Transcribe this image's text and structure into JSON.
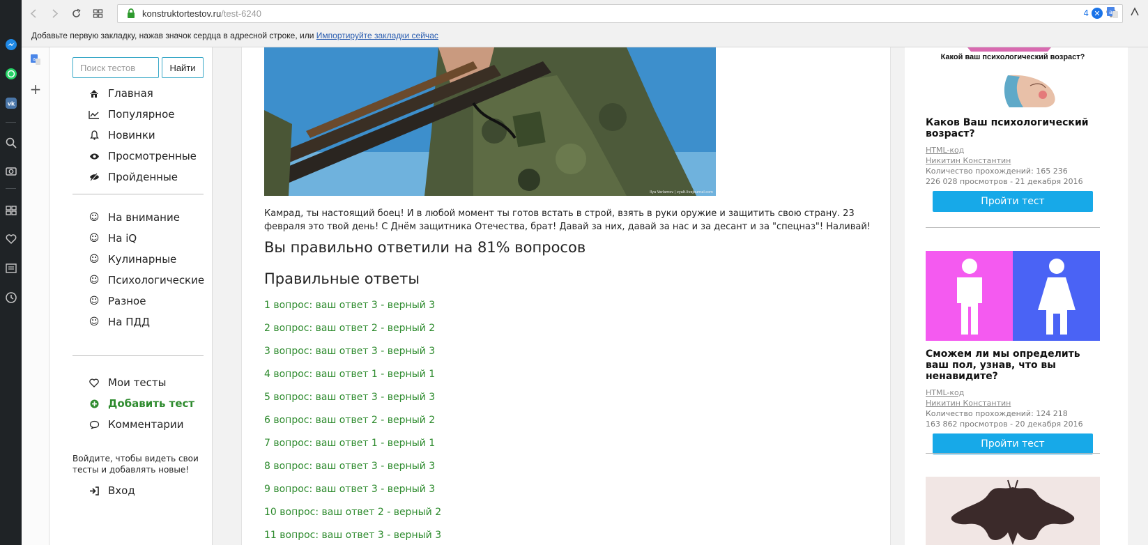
{
  "browser": {
    "url_host": "konstruktortestov.ru",
    "url_path": "/test-6240",
    "address_badge": "4",
    "bookmark_bar": {
      "text": "Добавьте первую закладку, нажав значок сердца в адресной строке, или",
      "link": "Импортируйте закладки сейчас"
    }
  },
  "sidebar": {
    "search_placeholder": "Поиск тестов",
    "search_button": "Найти",
    "main_menu": [
      {
        "label": "Главная",
        "icon": "home-icon",
        "glyph": "⌂"
      },
      {
        "label": "Популярное",
        "icon": "trend-icon",
        "glyph": "📈"
      },
      {
        "label": "Новинки",
        "icon": "bell-icon",
        "glyph": "🔔"
      },
      {
        "label": "Просмотренные",
        "icon": "eye-icon",
        "glyph": "👁"
      },
      {
        "label": "Пройденные",
        "icon": "eye-slash-icon",
        "glyph": "👁"
      }
    ],
    "categories": [
      {
        "label": "На внимание",
        "icon": "smile-icon"
      },
      {
        "label": "На iQ",
        "icon": "smile-icon"
      },
      {
        "label": "Кулинарные",
        "icon": "smile-icon"
      },
      {
        "label": "Психологические",
        "icon": "smile-icon"
      },
      {
        "label": "Разное",
        "icon": "smile-icon"
      },
      {
        "label": "На ПДД",
        "icon": "smile-icon"
      }
    ],
    "user_menu": {
      "my_tests": "Мои тесты",
      "add_test": "Добавить тест",
      "comments": "Комментарии"
    },
    "login_note": "Войдите, чтобы видеть свои тесты и добавлять новые!",
    "login": "Вход"
  },
  "main": {
    "hero_caption": "Ilya Varlamov | zyalt.livejournal.com",
    "result_text": "Камрад, ты настоящий боец! И в любой момент ты готов встать в строй, взять в руки оружие и защитить свою страну. 23 февраля это твой день! С Днём защитника Отечества, брат! Давай за них, давай за нас и за десант и за \"спецназ\"! Наливай!",
    "score": "Вы правильно ответили на 81% вопросов",
    "answers_title": "Правильные ответы",
    "answers": [
      "1 вопрос: ваш ответ 3 - верный 3",
      "2 вопрос: ваш ответ 2 - верный 2",
      "3 вопрос: ваш ответ 3 - верный 3",
      "4 вопрос: ваш ответ 1 - верный 1",
      "5 вопрос: ваш ответ 3 - верный 3",
      "6 вопрос: ваш ответ 2 - верный 2",
      "7 вопрос: ваш ответ 1 - верный 1",
      "8 вопрос: ваш ответ 3 - верный 3",
      "9 вопрос: ваш ответ 3 - верный 3",
      "10 вопрос: ваш ответ 2 - верный 2",
      "11 вопрос: ваш ответ 3 - верный 3"
    ]
  },
  "related": [
    {
      "image_text": "Какой ваш психологический возраст?",
      "title": "Каков Ваш психологический возраст?",
      "html_link": "HTML-код",
      "author": "Никитин Константин",
      "passes": "Количество прохождений: 165 236",
      "views": "226 028 просмотров - 21 декабря 2016",
      "button": "Пройти тест"
    },
    {
      "title": "Сможем ли мы определить ваш пол, узнав, что вы ненавидите?",
      "html_link": "HTML-код",
      "author": "Никитин Константин",
      "passes": "Количество прохождений: 124 218",
      "views": "163 862 просмотров - 20 декабря 2016",
      "button": "Пройти тест"
    }
  ],
  "colors": {
    "accent_green": "#2e8b2e",
    "button_blue": "#17a9e8",
    "pink_panel": "#f45af0",
    "blue_panel": "#4a63f5"
  }
}
